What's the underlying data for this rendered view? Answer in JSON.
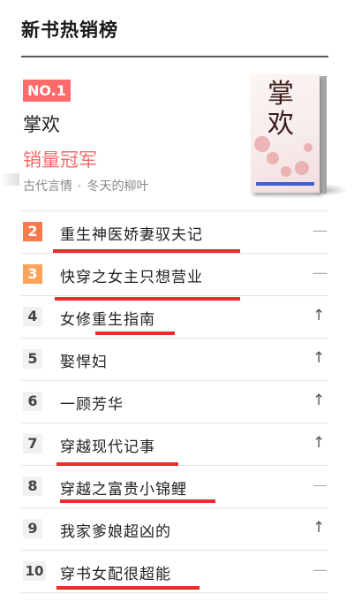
{
  "header": {
    "title": "新书热销榜"
  },
  "top_pick": {
    "rank_label": "NO.1",
    "book_name": "掌欢",
    "tag": "销量冠军",
    "genre": "古代言情",
    "separator": "·",
    "author": "冬天的柳叶",
    "cover_title": "掌欢"
  },
  "list": {
    "items": [
      {
        "rank": "2",
        "title": "重生神医娇妻驭夫记",
        "trend": "—"
      },
      {
        "rank": "3",
        "title": "快穿之女主只想营业",
        "trend": "—"
      },
      {
        "rank": "4",
        "title": "女修重生指南",
        "trend": "↑"
      },
      {
        "rank": "5",
        "title": "娶悍妇",
        "trend": "↑"
      },
      {
        "rank": "6",
        "title": "一顾芳华",
        "trend": "↑"
      },
      {
        "rank": "7",
        "title": "穿越现代记事",
        "trend": "↑"
      },
      {
        "rank": "8",
        "title": "穿越之富贵小锦鲤",
        "trend": "—"
      },
      {
        "rank": "9",
        "title": "我家爹娘超凶的",
        "trend": "↑"
      },
      {
        "rank": "10",
        "title": "穿书女配很超能",
        "trend": "—"
      }
    ]
  },
  "colors": {
    "rank_2": "#f7794e",
    "rank_3": "#fba35a",
    "no1_badge": "#ff6a6a",
    "tag": "#f26a6a",
    "annotation_underline": "#ee2a2a"
  },
  "icons": {
    "up": "arrow-up-icon",
    "flat": "dash-icon"
  }
}
